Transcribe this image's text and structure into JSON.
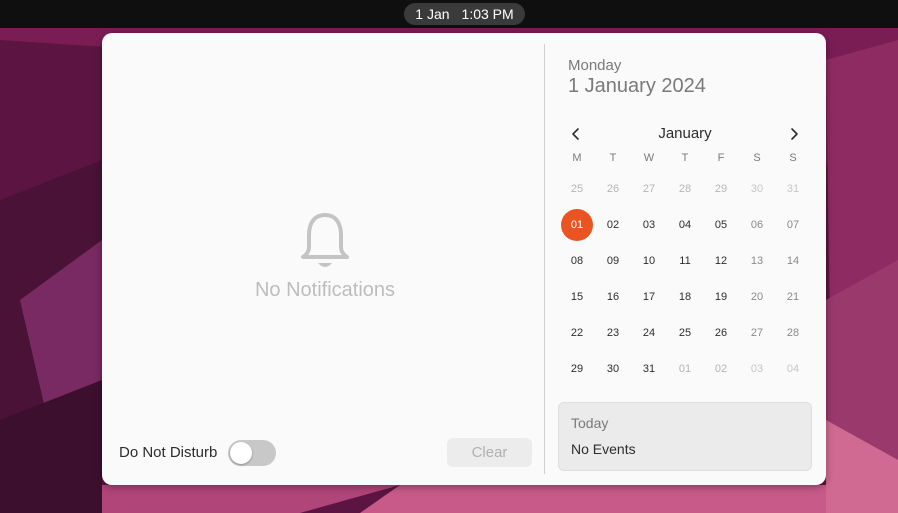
{
  "topbar": {
    "clock_date": "1 Jan",
    "clock_time": "1:03 PM"
  },
  "notifications": {
    "empty_icon": "bell-icon",
    "empty_text": "No Notifications",
    "do_not_disturb_label": "Do Not Disturb",
    "do_not_disturb_on": false,
    "clear_label": "Clear"
  },
  "calendar": {
    "weekday": "Monday",
    "full_date": "1 January 2024",
    "month": "January",
    "prev_icon": "chevron-left-icon",
    "next_icon": "chevron-right-icon",
    "weekday_headers": [
      "M",
      "T",
      "W",
      "T",
      "F",
      "S",
      "S"
    ],
    "weeks": [
      [
        "25",
        "26",
        "27",
        "28",
        "29",
        "30",
        "31"
      ],
      [
        "01",
        "02",
        "03",
        "04",
        "05",
        "06",
        "07"
      ],
      [
        "08",
        "09",
        "10",
        "11",
        "12",
        "13",
        "14"
      ],
      [
        "15",
        "16",
        "17",
        "18",
        "19",
        "20",
        "21"
      ],
      [
        "22",
        "23",
        "24",
        "25",
        "26",
        "27",
        "28"
      ],
      [
        "29",
        "30",
        "31",
        "01",
        "02",
        "03",
        "04"
      ]
    ],
    "selected_day": "01"
  },
  "events": {
    "title": "Today",
    "text": "No Events"
  },
  "colors": {
    "accent": "#e95420",
    "panel_background": "#fafafa",
    "topbar": "#0f0f0f"
  }
}
